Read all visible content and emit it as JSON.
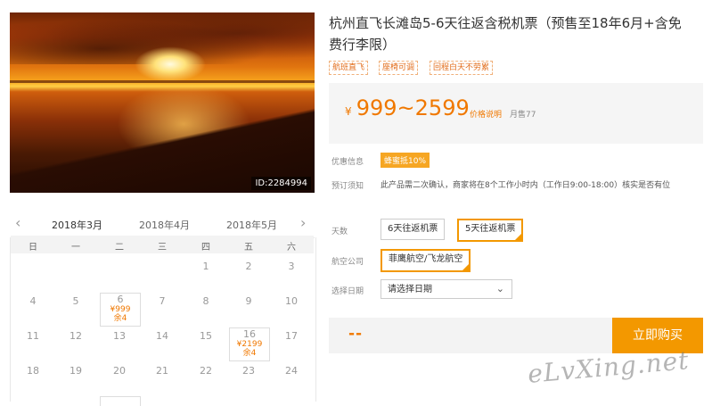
{
  "photo": {
    "id_label": "ID:2284994"
  },
  "calendar": {
    "prev_icon": "chevron-left-icon",
    "next_icon": "chevron-right-icon",
    "months": [
      "2018年3月",
      "2018年4月",
      "2018年5月"
    ],
    "weekdays": [
      "日",
      "一",
      "二",
      "三",
      "四",
      "五",
      "六"
    ],
    "days": {
      "d1": "1",
      "d2": "2",
      "d3": "3",
      "d4": "4",
      "d5": "5",
      "d6": "6",
      "d7": "7",
      "d8": "8",
      "d9": "9",
      "d10": "10",
      "d11": "11",
      "d12": "12",
      "d13": "13",
      "d14": "14",
      "d15": "15",
      "d16": "16",
      "d17": "17",
      "d18": "18",
      "d19": "19",
      "d20": "20",
      "d21": "21",
      "d22": "22",
      "d23": "23",
      "d24": "24"
    },
    "day6_price": "¥999",
    "day6_stock": "余4",
    "day16_price": "¥2199",
    "day16_stock": "余4"
  },
  "product": {
    "title": "杭州直飞长滩岛5-6天往返含税机票（预售至18年6月+含免费行李限）",
    "tags": [
      "航班直飞",
      "座椅可调",
      "回程白天不劳累"
    ],
    "price_symbol": "¥",
    "price_range": "999~2599",
    "price_note": "价格说明",
    "monthly_sales": "月售77",
    "promo_label": "优惠信息",
    "promo_badge": "蜂蜜抵10%",
    "booking_label": "预订须知",
    "booking_note": "此产品需二次确认，商家将在8个工作小时内（工作日9:00-18:00）核实是否有位",
    "days_label": "天数",
    "days_options": [
      "6天往返机票",
      "5天往返机票"
    ],
    "airline_label": "航空公司",
    "airline_option": "菲鹰航空/飞龙航空",
    "date_label": "选择日期",
    "date_placeholder": "请选择日期",
    "total_placeholder": "--",
    "buy_button": "立即购买"
  },
  "watermark": "eLvXing.net",
  "colors": {
    "accent": "#f39800",
    "price": "#f07800"
  }
}
